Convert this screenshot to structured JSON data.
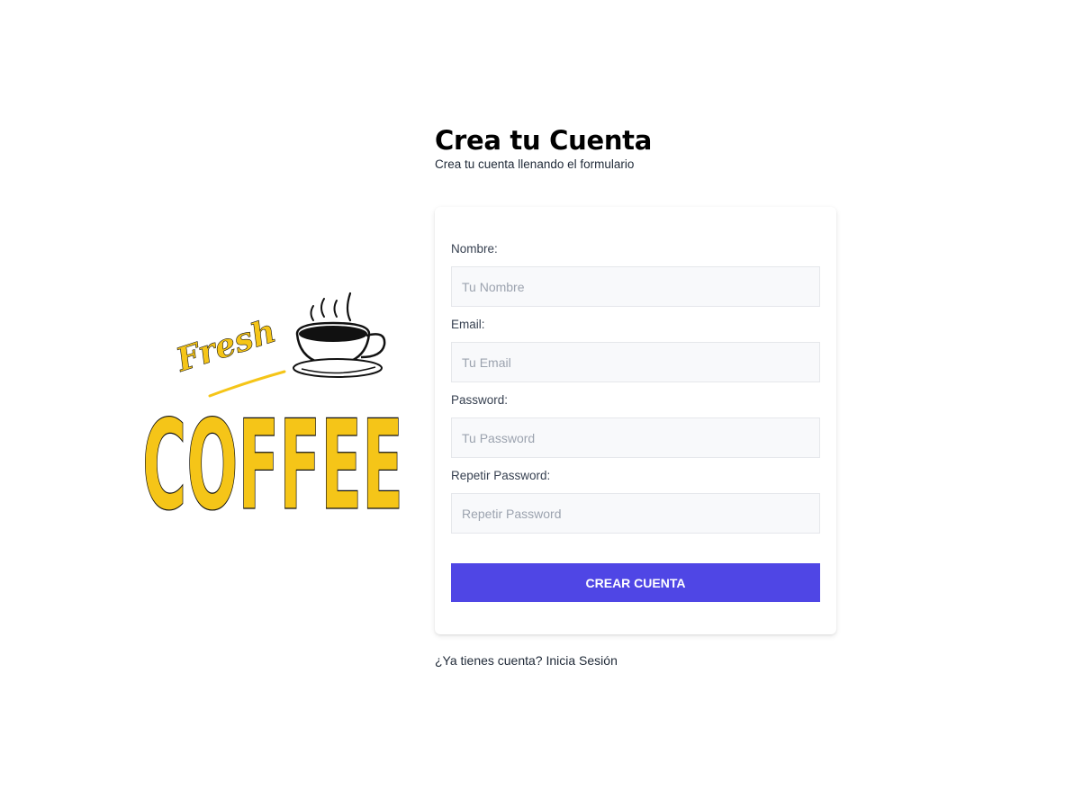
{
  "logo": {
    "word_fresh": "Fresh",
    "word_coffee": "COFFEE",
    "accent_color": "#f5c518"
  },
  "header": {
    "title": "Crea tu Cuenta",
    "subtitle": "Crea tu cuenta llenando el formulario"
  },
  "form": {
    "fields": [
      {
        "label": "Nombre:",
        "placeholder": "Tu Nombre",
        "value": ""
      },
      {
        "label": "Email:",
        "placeholder": "Tu Email",
        "value": ""
      },
      {
        "label": "Password:",
        "placeholder": "Tu Password",
        "value": ""
      },
      {
        "label": "Repetir Password:",
        "placeholder": "Repetir Password",
        "value": ""
      }
    ],
    "submit_label": "Crear Cuenta",
    "button_color": "#4f46e5"
  },
  "footer": {
    "login_link": "¿Ya tienes cuenta? Inicia Sesión"
  }
}
